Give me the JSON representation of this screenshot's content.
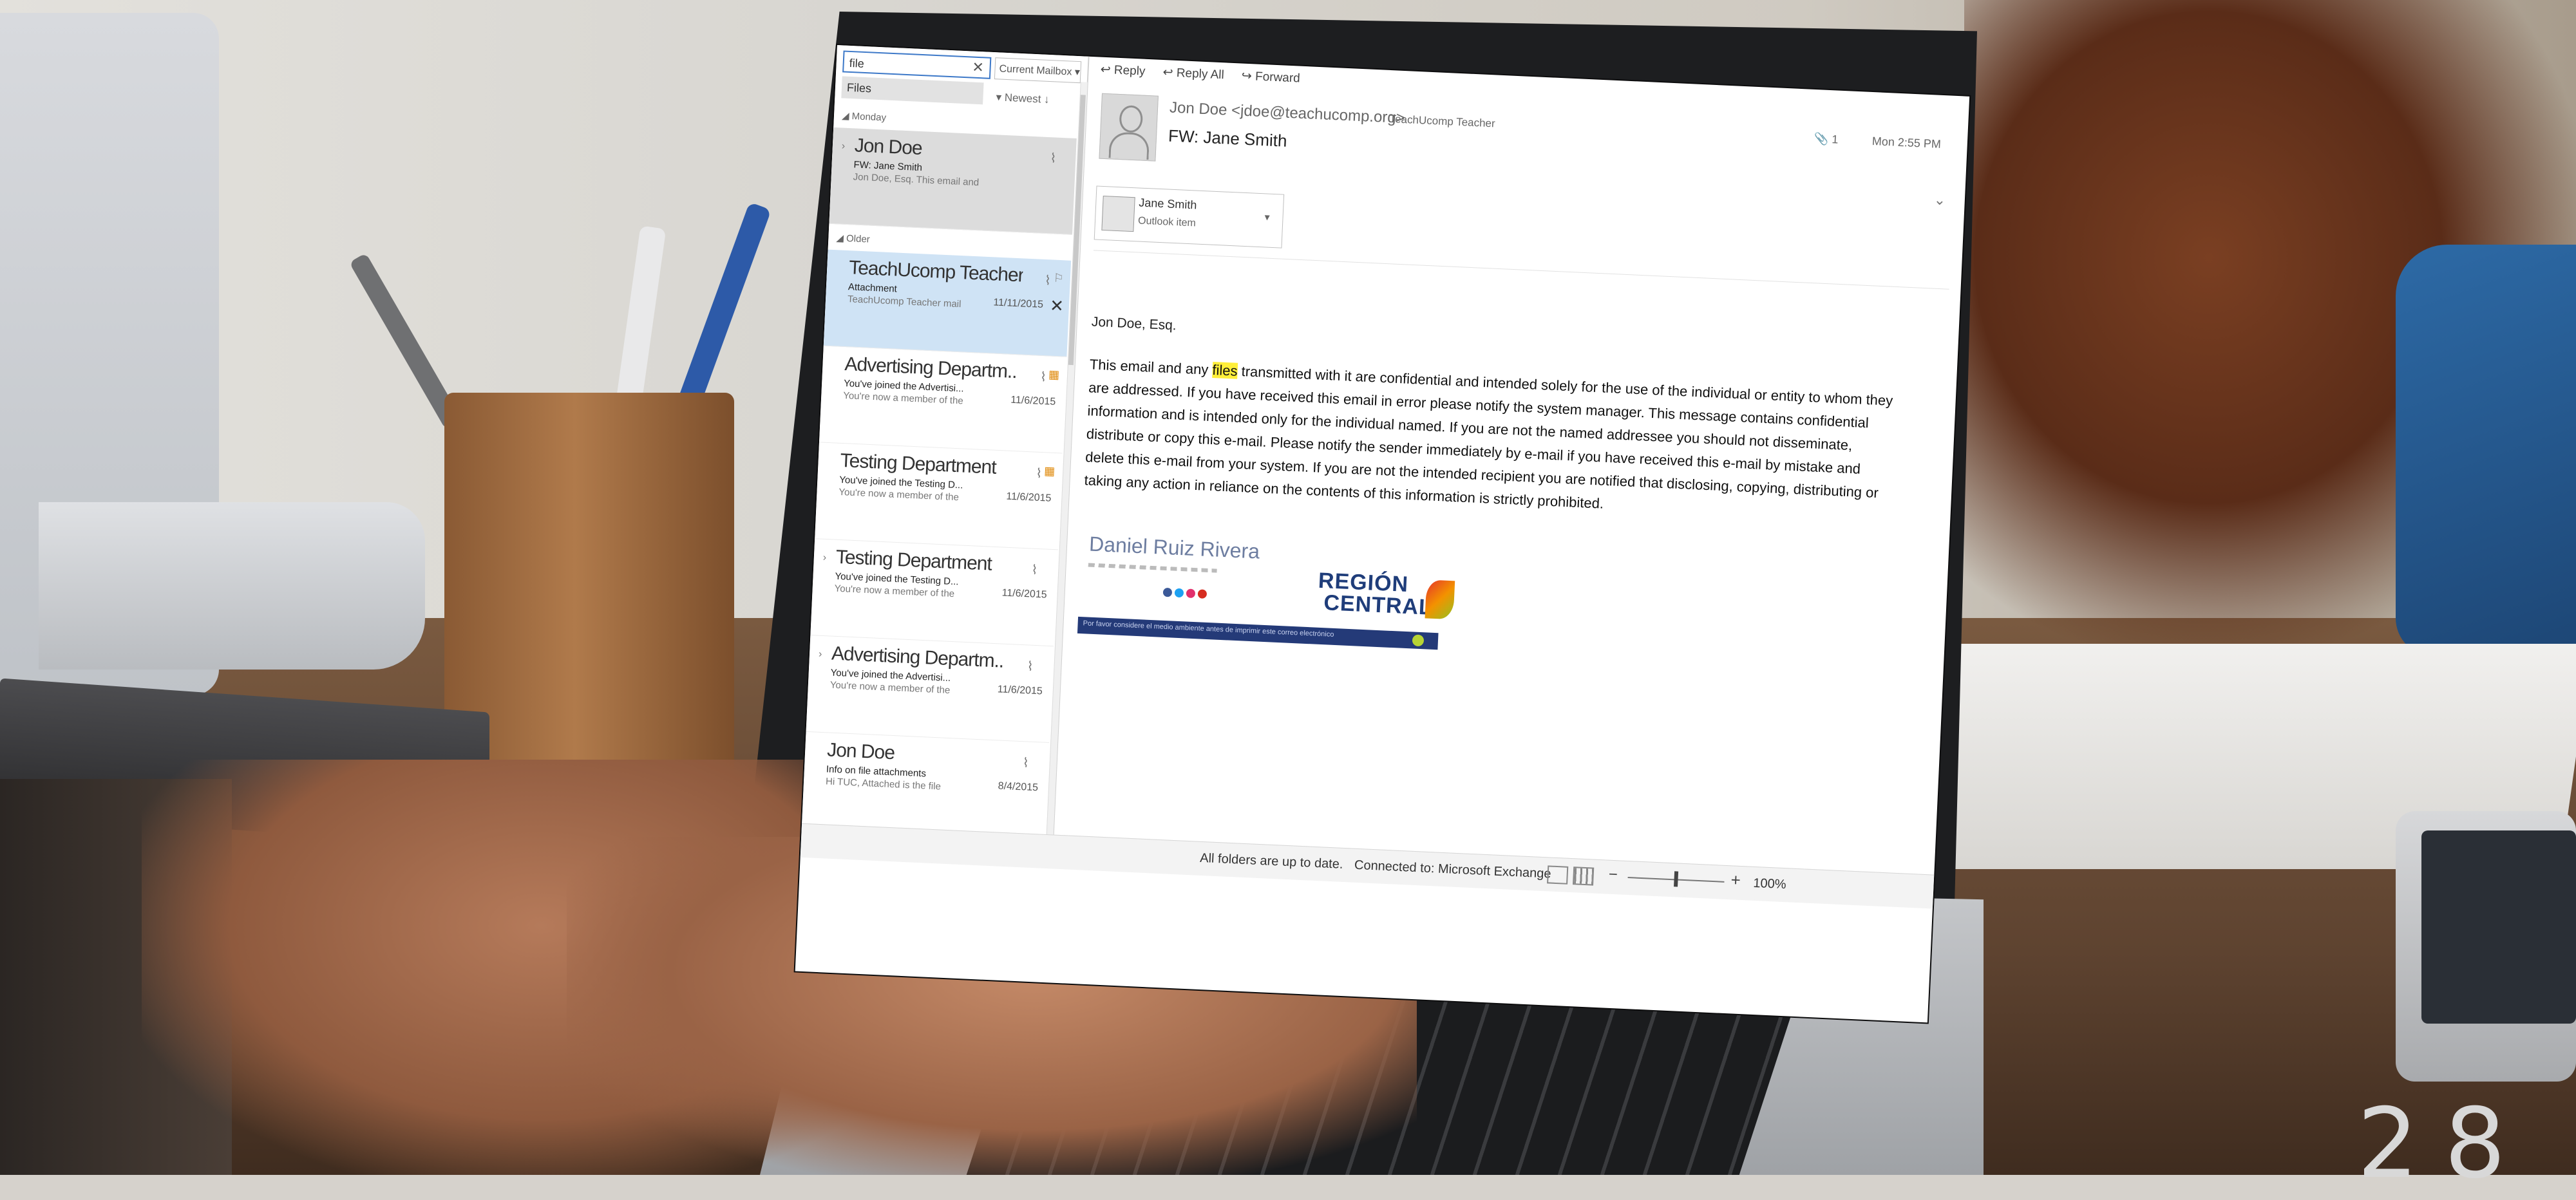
{
  "search": {
    "query": "file",
    "clear_icon": "close-icon",
    "scope": "Current Mailbox ▾",
    "suggestion": "Files"
  },
  "list": {
    "sort_label": "▾ Newest ↓",
    "groups": {
      "monday": "◢ Monday",
      "older": "◢ Older"
    },
    "items": [
      {
        "sender": "Jon Doe",
        "subject": "FW: Jane Smith",
        "preview": "Jon Doe, Esq. This email and",
        "date": ""
      },
      {
        "sender": "TeachUcomp Teacher",
        "subject": "Attachment",
        "preview": "TeachUcomp Teacher mail",
        "date": "11/11/2015"
      },
      {
        "sender": "Advertising Departm...",
        "subject": "You've joined the Advertisi...",
        "preview": "You're now a member of the",
        "date": "11/6/2015"
      },
      {
        "sender": "Testing Department",
        "subject": "You've joined the Testing D...",
        "preview": "You're now a member of the",
        "date": "11/6/2015"
      },
      {
        "sender": "Testing Department",
        "subject": "You've joined the Testing D...",
        "preview": "You're now a member of the",
        "date": "11/6/2015"
      },
      {
        "sender": "Advertising Departm...",
        "subject": "You've joined the Advertisi...",
        "preview": "You're now a member of the",
        "date": "11/6/2015"
      },
      {
        "sender": "Jon Doe",
        "subject": "Info on file attachments",
        "preview": "Hi TUC, Attached is the file",
        "date": "8/4/2015"
      }
    ]
  },
  "toolbar": {
    "reply": "↩ Reply",
    "reply_all": "↩ Reply All",
    "forward": "↪ Forward"
  },
  "message": {
    "from": "Jon Doe <jdoe@teachucomp.org>",
    "to": "TeachUcomp Teacher",
    "attachment_count": "📎 1",
    "date": "Mon 2:55 PM",
    "subject": "FW: Jane Smith",
    "attachment": {
      "name": "Jane Smith",
      "type": "Outlook item"
    },
    "greeting": "Jon Doe, Esq.",
    "body_before_highlight": "This email and any ",
    "body_highlight": "files",
    "body_after_highlight": " transmitted with it are confidential and intended solely for the use of the individual or entity to whom they are addressed. If you have received this email in error please notify the system manager. This message contains confidential information and is intended only for the individual named. If you are not the named addressee you should not disseminate, distribute or copy this e-mail. Please notify the sender immediately by e-mail if you have received this e-mail by mistake and delete this e-mail from your system. If you are not the intended recipient you are notified that disclosing, copying, distributing or taking any action in reliance on the contents of this information is strictly prohibited."
  },
  "signature": {
    "name": "Daniel Ruiz Rivera",
    "footer": "Por favor considere el medio ambiente antes de imprimir este correo electrónico",
    "logo_line1": "REGIÓN",
    "logo_line2": "CENTRAL",
    "social_colors": [
      "#3b5998",
      "#1da1f2",
      "#e1306c",
      "#d62d20"
    ]
  },
  "status": {
    "up_to_date": "All folders are up to date.",
    "connection": "Connected to: Microsoft Exchange",
    "zoom": "100%",
    "zoom_level": 0.5
  },
  "page_number": "28",
  "colors": {
    "accent": "#3c78c8",
    "highlight": "#ffef3a",
    "logo": "#1f3d7a"
  }
}
